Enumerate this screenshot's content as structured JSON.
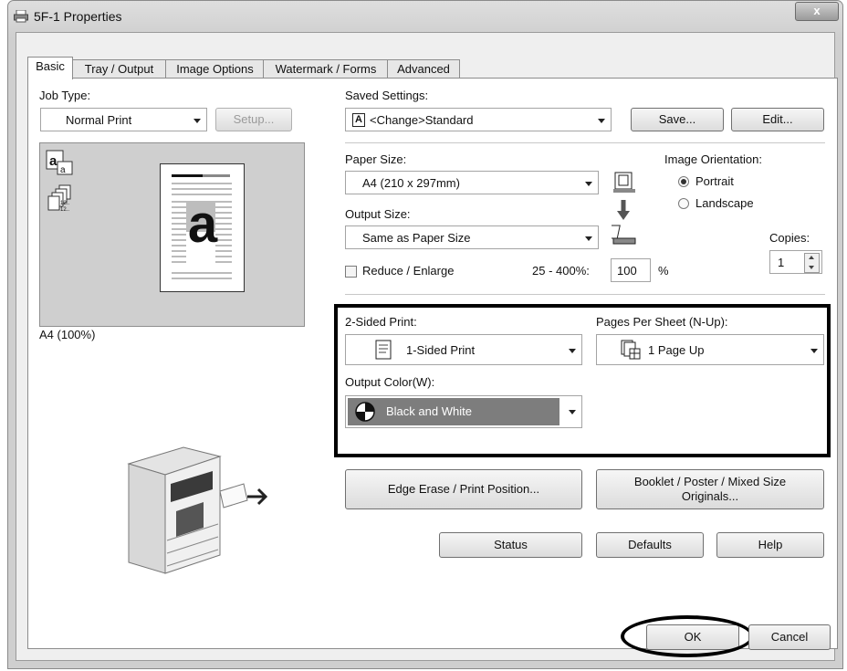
{
  "window": {
    "title": "5F-1 Properties",
    "close_label": "x"
  },
  "tabs": [
    {
      "label": "Basic"
    },
    {
      "label": "Tray / Output"
    },
    {
      "label": "Image Options"
    },
    {
      "label": "Watermark / Forms"
    },
    {
      "label": "Advanced"
    }
  ],
  "job_type": {
    "label": "Job Type:",
    "value": "Normal Print",
    "setup_label": "Setup..."
  },
  "preview": {
    "caption": "A4 (100%)",
    "big_letter": "a",
    "small_letter": "a"
  },
  "saved_settings": {
    "label": "Saved Settings:",
    "value": "<Change>Standard",
    "save_label": "Save...",
    "edit_label": "Edit..."
  },
  "paper_size": {
    "label": "Paper Size:",
    "value": "A4 (210 x 297mm)"
  },
  "output_size": {
    "label": "Output Size:",
    "value": "Same as Paper Size"
  },
  "orientation": {
    "label": "Image Orientation:",
    "portrait": "Portrait",
    "landscape": "Landscape",
    "selected": "Portrait"
  },
  "reduce_enlarge": {
    "label": "Reduce / Enlarge",
    "range_label": "25 - 400%:",
    "value": "100",
    "unit": "%"
  },
  "copies": {
    "label": "Copies:",
    "value": "1"
  },
  "two_sided": {
    "label": "2-Sided Print:",
    "value": "1-Sided Print"
  },
  "pages_per_sheet": {
    "label": "Pages Per Sheet (N-Up):",
    "value": "1 Page Up"
  },
  "output_color": {
    "label": "Output Color(W):",
    "value": "Black and White"
  },
  "buttons": {
    "edge_erase": "Edge Erase / Print Position...",
    "booklet": "Booklet / Poster / Mixed Size Originals...",
    "status": "Status",
    "defaults": "Defaults",
    "help": "Help",
    "ok": "OK",
    "cancel": "Cancel"
  }
}
